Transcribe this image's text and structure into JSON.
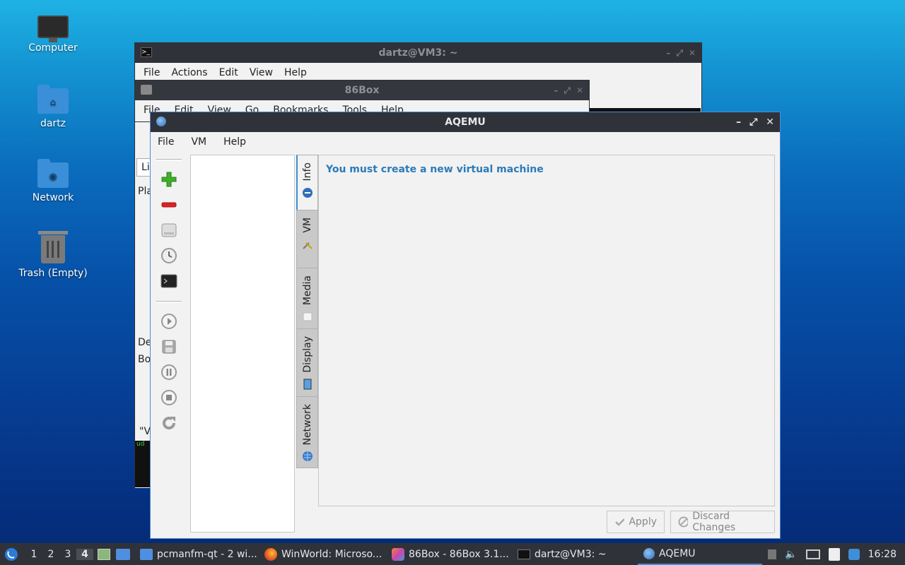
{
  "desktop": {
    "icons": [
      {
        "label": "Computer"
      },
      {
        "label": "dartz"
      },
      {
        "label": "Network"
      },
      {
        "label": "Trash (Empty)"
      }
    ]
  },
  "terminal": {
    "title": "dartz@VM3: ~",
    "menu": [
      "File",
      "Actions",
      "Edit",
      "View",
      "Help"
    ],
    "fragments": {
      "a": "Lis",
      "b": "Pla",
      "c": "De",
      "d": "Bo",
      "e": "\"V",
      "f": "ud"
    }
  },
  "box86": {
    "title": "86Box",
    "menu": [
      "File",
      "Edit",
      "View",
      "Go",
      "Bookmarks",
      "Tools",
      "Help"
    ]
  },
  "aqemu": {
    "title": "AQEMU",
    "menu": [
      "File",
      "VM",
      "Help"
    ],
    "tabs": [
      {
        "label": "Info",
        "icon": "info-icon"
      },
      {
        "label": "VM",
        "icon": "tools-icon"
      },
      {
        "label": "Media",
        "icon": "media-icon"
      },
      {
        "label": "Display",
        "icon": "display-icon"
      },
      {
        "label": "Network",
        "icon": "network-icon"
      }
    ],
    "message": "You must create a new virtual machine",
    "apply_label": "Apply",
    "discard_label": "Discard Changes"
  },
  "taskbar": {
    "workspaces": [
      "1",
      "2",
      "3",
      "4"
    ],
    "current_workspace": "4",
    "tasks": [
      {
        "label": "pcmanfm-qt - 2 wi..."
      },
      {
        "label": "WinWorld: Microso..."
      },
      {
        "label": "86Box - 86Box 3.1..."
      },
      {
        "label": "dartz@VM3: ~"
      },
      {
        "label": "AQEMU"
      }
    ],
    "clock": "16:28"
  },
  "colors": {
    "accent": "#3b8ed8",
    "message": "#2b7bb9",
    "titlebar": "#2f3238"
  }
}
